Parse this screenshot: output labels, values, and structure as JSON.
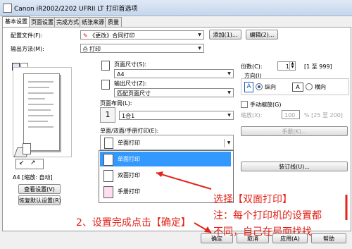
{
  "window": {
    "title": "Canon iR2002/2202 UFRII LT 打印首选项"
  },
  "tabs": [
    {
      "label": "基本设置",
      "active": true
    },
    {
      "label": "页面设置",
      "active": false
    },
    {
      "label": "完成方式",
      "active": false
    },
    {
      "label": "纸张来源",
      "active": false
    },
    {
      "label": "质量",
      "active": false
    }
  ],
  "profile": {
    "label": "配置文件(F):",
    "value": "《更改》合同打印",
    "add_button": "添加(1)...",
    "edit_button": "编辑(2)..."
  },
  "output": {
    "label": "输出方法(M):",
    "value": "打印"
  },
  "left": {
    "status": "A4 [缩放: 自动]",
    "view_settings": "查看设置(V)",
    "restore_defaults": "恢复默认设置(R)"
  },
  "page_size": {
    "label": "页面尺寸(S):",
    "value": "A4"
  },
  "output_size": {
    "label": "输出尺寸(Z):",
    "value": "匹配页面尺寸"
  },
  "layout": {
    "label": "页面布局(L):",
    "value": "1合1",
    "number": "1"
  },
  "print_style": {
    "label": "单面/双面/手册打印(E):",
    "value": "单面打印",
    "options": [
      "单面打印",
      "双面打印",
      "手册打印"
    ],
    "selected_index": 0
  },
  "copies": {
    "label": "份数(C):",
    "value": "1",
    "range": "[1 至 999]"
  },
  "orientation": {
    "label": "方向(I)",
    "portrait": "纵向",
    "landscape": "横向"
  },
  "manual_scaling": {
    "label": "手动缩放(G)",
    "scale_label": "缩放(X):",
    "scale_value": "100",
    "scale_range": "% [25 至 200]"
  },
  "booklet_button": "手册(K)...",
  "binding_button": "装订线(U)...",
  "footer": {
    "ok": "确定",
    "cancel": "取消",
    "apply": "应用(A)",
    "help": "帮助"
  },
  "annotations": {
    "select_title": "选择【双面打印】",
    "note": "注：每个打印机的设置都",
    "note2": "不同，自己在局面找找",
    "step2": "2、设置完成点击【确定】"
  }
}
